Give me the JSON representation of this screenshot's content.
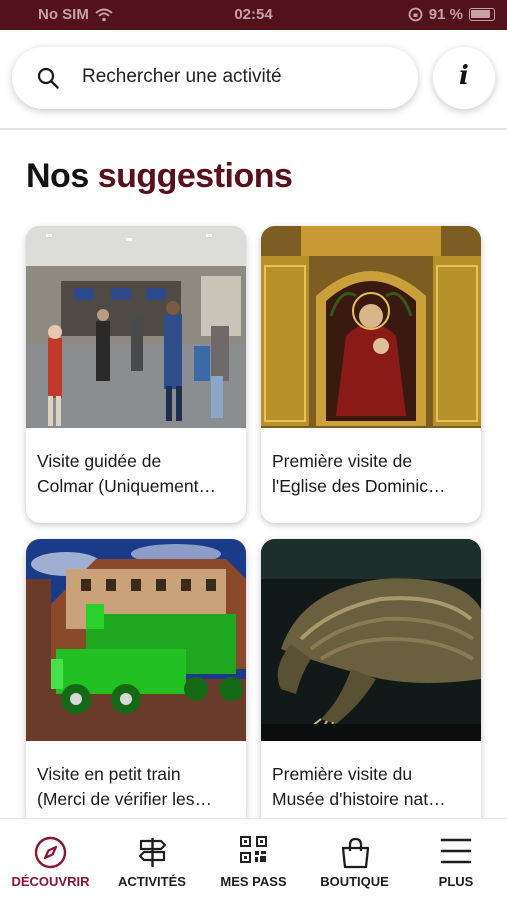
{
  "status_bar": {
    "carrier": "No SIM",
    "time": "02:54",
    "battery": "91 %"
  },
  "search": {
    "placeholder": "Rechercher une activité"
  },
  "section": {
    "title_plain": "Nos ",
    "title_accent": "suggestions"
  },
  "cards": [
    {
      "line1": "Visite guidée de",
      "line2": "Colmar (Uniquement…"
    },
    {
      "line1": "Première visite de",
      "line2": "l'Eglise des Dominic…"
    },
    {
      "line1": "Visite en petit train",
      "line2": "(Merci de vérifier les…"
    },
    {
      "line1": "Première visite du",
      "line2": "Musée d'histoire nat…"
    }
  ],
  "tabs": [
    {
      "label": "DÉCOUVRIR",
      "icon": "compass-icon",
      "active": true
    },
    {
      "label": "ACTIVITÉS",
      "icon": "signpost-icon",
      "active": false
    },
    {
      "label": "MES PASS",
      "icon": "qr-code-icon",
      "active": false
    },
    {
      "label": "BOUTIQUE",
      "icon": "shopping-bag-icon",
      "active": false
    },
    {
      "label": "PLUS",
      "icon": "menu-icon",
      "active": false
    }
  ],
  "colors": {
    "accent": "#5a0f1e",
    "status_bar": "#52111b",
    "active_tab": "#8b1530"
  }
}
